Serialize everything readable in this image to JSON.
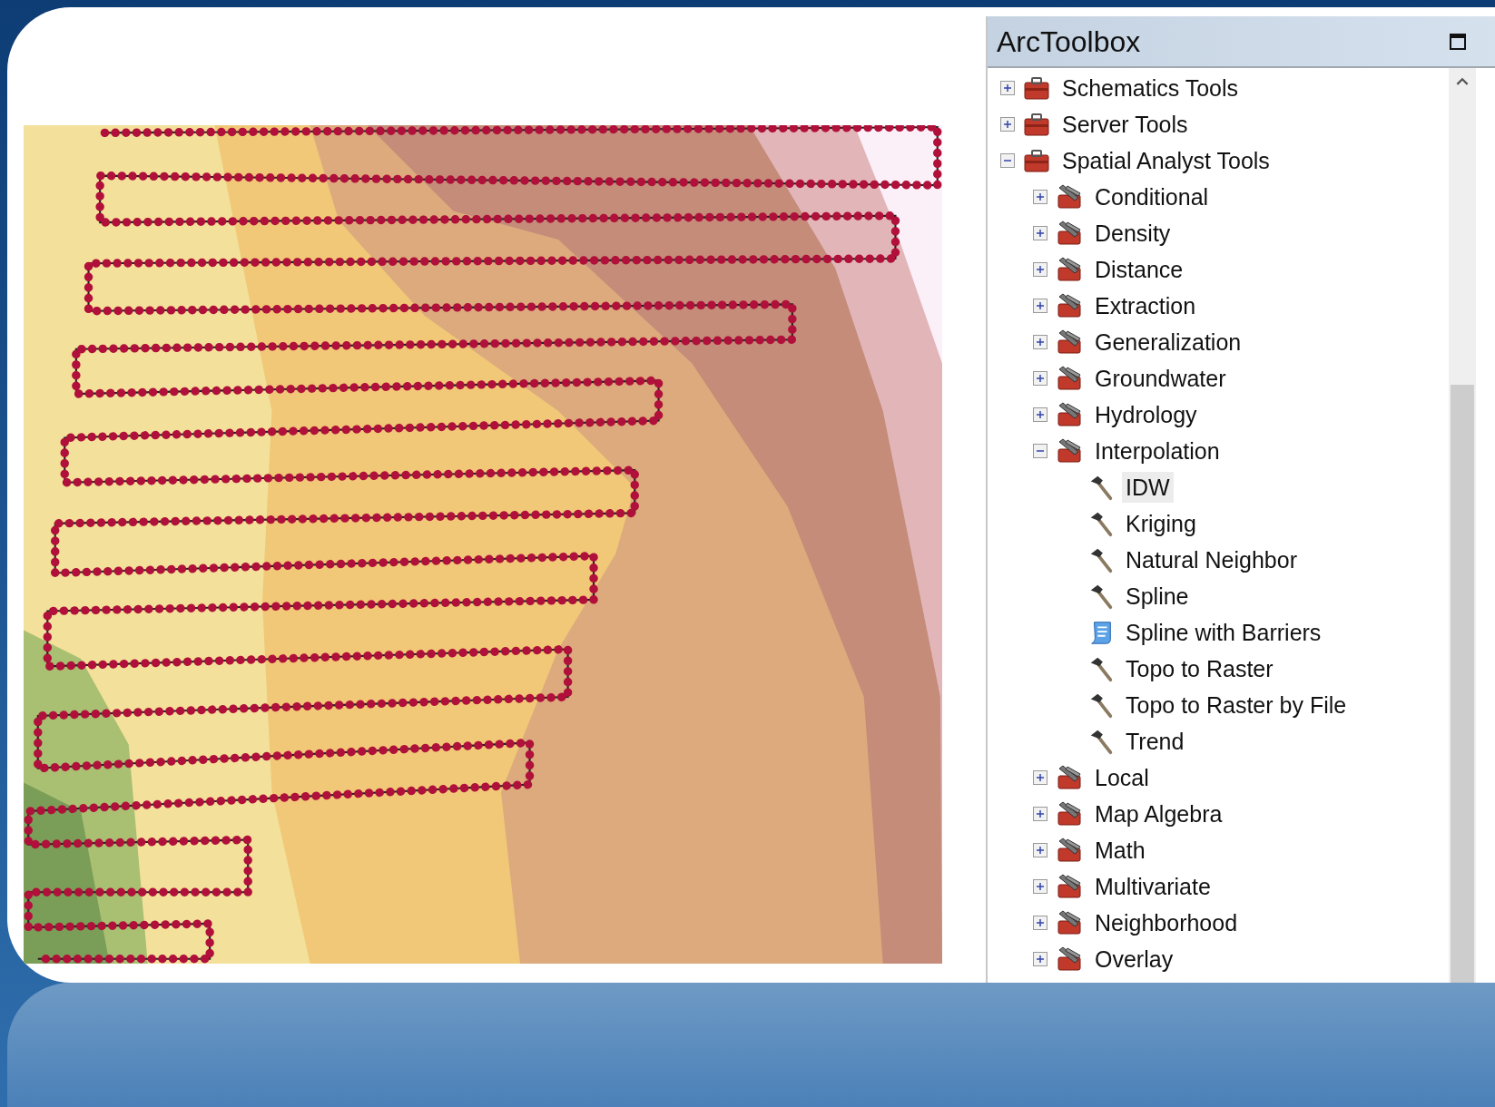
{
  "panel": {
    "title": "ArcToolbox"
  },
  "tree": [
    {
      "label": "Schematics Tools",
      "kind": "toolbox",
      "expanded": false,
      "selected": false
    },
    {
      "label": "Server Tools",
      "kind": "toolbox",
      "expanded": false,
      "selected": false
    },
    {
      "label": "Spatial Analyst Tools",
      "kind": "toolbox",
      "expanded": true,
      "selected": false,
      "children": [
        {
          "label": "Conditional",
          "kind": "toolset",
          "expanded": false,
          "selected": false
        },
        {
          "label": "Density",
          "kind": "toolset",
          "expanded": false,
          "selected": false
        },
        {
          "label": "Distance",
          "kind": "toolset",
          "expanded": false,
          "selected": false
        },
        {
          "label": "Extraction",
          "kind": "toolset",
          "expanded": false,
          "selected": false
        },
        {
          "label": "Generalization",
          "kind": "toolset",
          "expanded": false,
          "selected": false
        },
        {
          "label": "Groundwater",
          "kind": "toolset",
          "expanded": false,
          "selected": false
        },
        {
          "label": "Hydrology",
          "kind": "toolset",
          "expanded": false,
          "selected": false
        },
        {
          "label": "Interpolation",
          "kind": "toolset",
          "expanded": true,
          "selected": false,
          "children": [
            {
              "label": "IDW",
              "kind": "tool",
              "selected": true
            },
            {
              "label": "Kriging",
              "kind": "tool",
              "selected": false
            },
            {
              "label": "Natural Neighbor",
              "kind": "tool",
              "selected": false
            },
            {
              "label": "Spline",
              "kind": "tool",
              "selected": false
            },
            {
              "label": "Spline with Barriers",
              "kind": "script",
              "selected": false
            },
            {
              "label": "Topo to Raster",
              "kind": "tool",
              "selected": false
            },
            {
              "label": "Topo to Raster by File",
              "kind": "tool",
              "selected": false
            },
            {
              "label": "Trend",
              "kind": "tool",
              "selected": false
            }
          ]
        },
        {
          "label": "Local",
          "kind": "toolset",
          "expanded": false,
          "selected": false
        },
        {
          "label": "Map Algebra",
          "kind": "toolset",
          "expanded": false,
          "selected": false
        },
        {
          "label": "Math",
          "kind": "toolset",
          "expanded": false,
          "selected": false
        },
        {
          "label": "Multivariate",
          "kind": "toolset",
          "expanded": false,
          "selected": false
        },
        {
          "label": "Neighborhood",
          "kind": "toolset",
          "expanded": false,
          "selected": false
        },
        {
          "label": "Overlay",
          "kind": "toolset",
          "expanded": false,
          "selected": false
        }
      ]
    }
  ]
}
